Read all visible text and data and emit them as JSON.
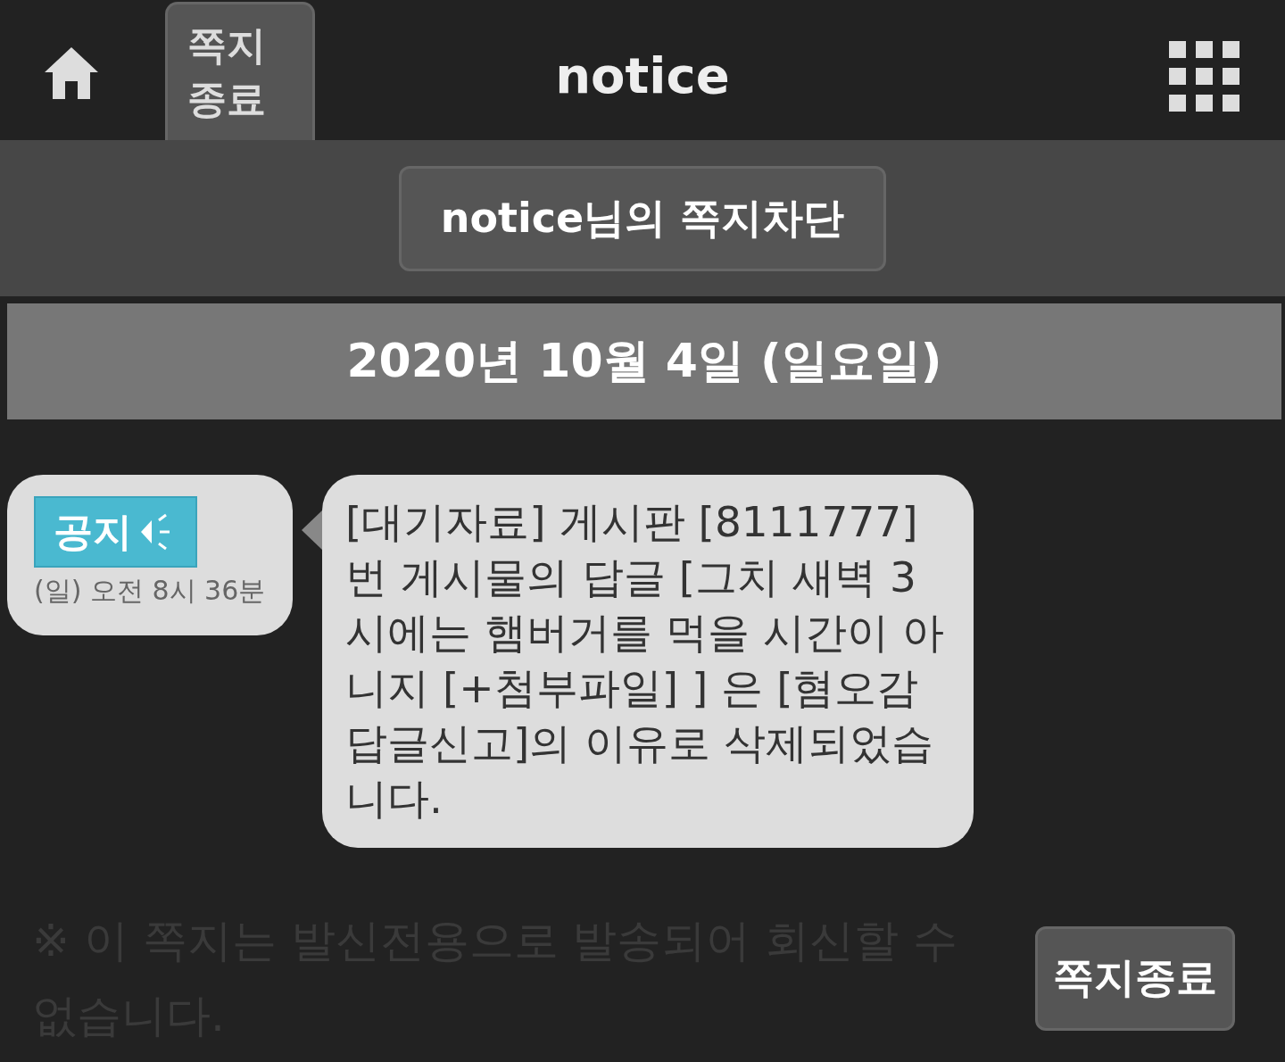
{
  "header": {
    "tab_label": "쪽지\n종료",
    "title": "notice"
  },
  "block_button": "notice님의 쪽지차단",
  "date": "2020년 10월 4일 (일요일)",
  "message": {
    "badge": "공지",
    "time": "(일) 오전 8시 36분",
    "text": "[대기자료] 게시판 [8111777]번 게시물의 답글 [그치 새벽 3시에는 햄버거를 먹을 시간이 아니지 [+첨부파일] ] 은 [혐오감 답글신고]의 이유로 삭제되었습니다."
  },
  "footer": {
    "note": "※ 이 쪽지는 발신전용으로 발송되어 회신할 수 없습니다.",
    "close_button": "쪽지종료"
  }
}
